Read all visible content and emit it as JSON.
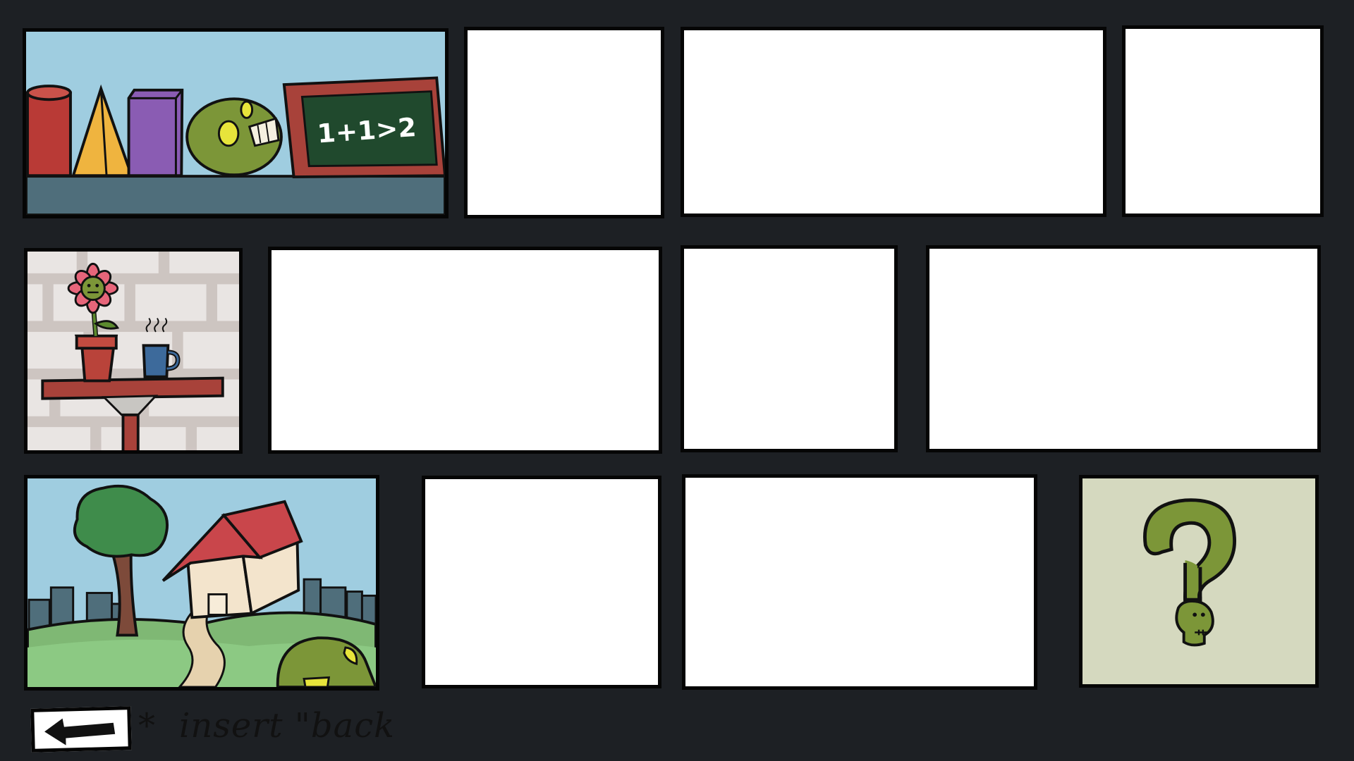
{
  "puzzle_grid": {
    "rows": [
      {
        "panels": [
          {
            "id": "shelf-scene",
            "state": "revealed",
            "depicts": "shapes-shelf-with-chalkboard",
            "chalkboard_text": "1+1>2"
          },
          {
            "id": "blank-1",
            "state": "blank"
          },
          {
            "id": "blank-2",
            "state": "blank"
          },
          {
            "id": "blank-3",
            "state": "blank"
          }
        ]
      },
      {
        "panels": [
          {
            "id": "table-scene",
            "state": "revealed",
            "depicts": "potted-flower-and-mug-on-table"
          },
          {
            "id": "blank-4",
            "state": "blank"
          },
          {
            "id": "blank-5",
            "state": "blank"
          },
          {
            "id": "blank-6",
            "state": "blank"
          }
        ]
      },
      {
        "panels": [
          {
            "id": "house-scene",
            "state": "revealed",
            "depicts": "house-tree-city-skyline"
          },
          {
            "id": "blank-7",
            "state": "blank"
          },
          {
            "id": "blank-8",
            "state": "blank"
          },
          {
            "id": "mystery-card",
            "state": "revealed",
            "depicts": "question-mark-with-zombie-head"
          }
        ]
      }
    ]
  },
  "footer": {
    "back_icon": "left-arrow-icon",
    "note_marker": "*",
    "note_text": "insert \"back\""
  },
  "colors": {
    "background": "#1d2024",
    "panel_border": "#050505",
    "blank_panel": "#ffffff",
    "zombie_green": "#7c9638",
    "mystery_bg": "#d5d9bf"
  }
}
